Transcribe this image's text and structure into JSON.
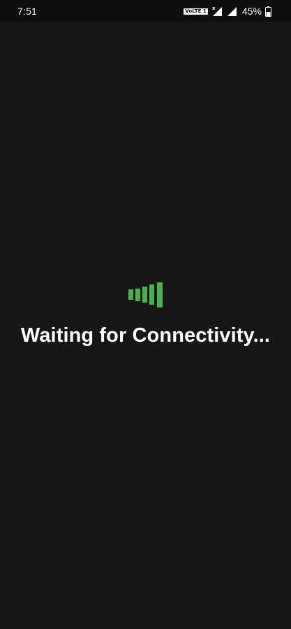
{
  "status_bar": {
    "time": "7:51",
    "volte_label": "VoLTE 1",
    "battery_percent": "45%",
    "icons": [
      "volte-icon",
      "signal-no-data-icon",
      "signal-icon",
      "battery-icon"
    ]
  },
  "main": {
    "message": "Waiting for Connectivity...",
    "icon": "connectivity-bars-icon"
  },
  "colors": {
    "background": "#171717",
    "status_bar_background": "#0e0e0e",
    "text": "#ffffff",
    "accent_green": "#4caf50"
  }
}
